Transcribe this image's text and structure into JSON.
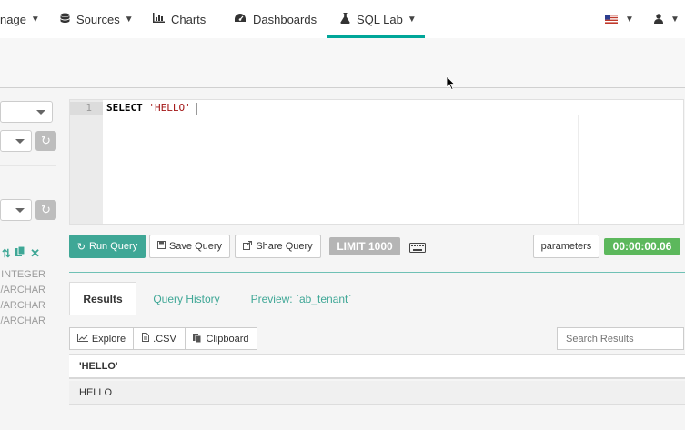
{
  "nav": {
    "manage_label": "nage",
    "sources_label": "Sources",
    "charts_label": "Charts",
    "dashboards_label": "Dashboards",
    "sqllab_label": "SQL Lab"
  },
  "editor": {
    "line_number": "1",
    "sql_keyword": "SELECT",
    "sql_string": "'HELLO'"
  },
  "toolbar": {
    "run_label": "Run Query",
    "save_label": "Save Query",
    "share_label": "Share Query",
    "limit_label": "LIMIT 1000",
    "parameters_label": "parameters",
    "timer": "00:00:00.06"
  },
  "tabs": [
    {
      "label": "Results"
    },
    {
      "label": "Query History"
    },
    {
      "label": "Preview: `ab_tenant`"
    }
  ],
  "results": {
    "explore_label": "Explore",
    "csv_label": ".CSV",
    "clipboard_label": "Clipboard",
    "search_placeholder": "Search Results",
    "columns": [
      "'HELLO'"
    ],
    "rows": [
      [
        "HELLO"
      ]
    ]
  },
  "left_panel": {
    "column_types": [
      "INTEGER",
      "/ARCHAR",
      "/ARCHAR",
      "/ARCHAR"
    ]
  },
  "colors": {
    "accent": "#00a699",
    "primary_button": "#3fa796",
    "timer_badge": "#5cb85c",
    "limit_badge": "#b5b5b5"
  }
}
